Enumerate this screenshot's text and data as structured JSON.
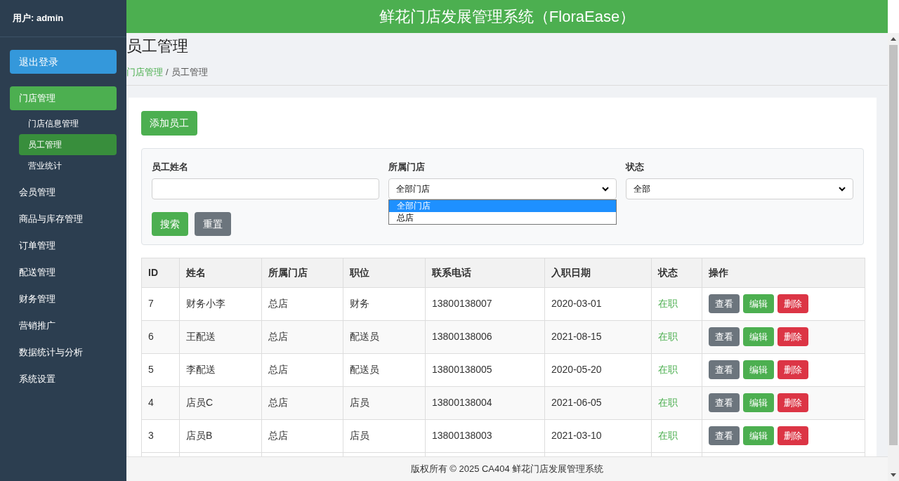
{
  "sidebar": {
    "user": "用户: admin",
    "logout": "退出登录",
    "items": [
      {
        "label": "门店管理",
        "selected": true,
        "children": [
          {
            "label": "门店信息管理",
            "selected": false
          },
          {
            "label": "员工管理",
            "selected": true
          },
          {
            "label": "营业统计",
            "selected": false
          }
        ]
      },
      {
        "label": "会员管理",
        "selected": false
      },
      {
        "label": "商品与库存管理",
        "selected": false
      },
      {
        "label": "订单管理",
        "selected": false
      },
      {
        "label": "配送管理",
        "selected": false
      },
      {
        "label": "财务管理",
        "selected": false
      },
      {
        "label": "营销推广",
        "selected": false
      },
      {
        "label": "数据统计与分析",
        "selected": false
      },
      {
        "label": "系统设置",
        "selected": false
      }
    ]
  },
  "header": {
    "title": "鲜花门店发展管理系统（FloraEase）"
  },
  "page": {
    "title": "员工管理",
    "breadcrumb": [
      {
        "label": "门店管理",
        "link": true
      },
      {
        "label": "员工管理",
        "link": false
      }
    ],
    "separator": "/"
  },
  "add_button": "添加员工",
  "filters": {
    "name": {
      "label": "员工姓名"
    },
    "store": {
      "label": "所属门店",
      "value": "全部门店",
      "open": true,
      "options": [
        {
          "label": "全部门店",
          "selected": true
        },
        {
          "label": "总店",
          "selected": false
        }
      ]
    },
    "status": {
      "label": "状态",
      "value": "全部"
    },
    "buttons": [
      {
        "label": "搜索",
        "kind": "primary"
      },
      {
        "label": "重置",
        "kind": "secondary"
      }
    ]
  },
  "table": {
    "columns": [
      "ID",
      "姓名",
      "所属门店",
      "职位",
      "联系电话",
      "入职日期",
      "状态",
      "操作"
    ],
    "rows": [
      {
        "cells": [
          "7",
          "财务小李",
          "总店",
          "财务",
          "13800138007",
          "2020-03-01"
        ],
        "status": "在职",
        "actions": [
          {
            "label": "查看",
            "kind": "view"
          },
          {
            "label": "编辑",
            "kind": "edit"
          },
          {
            "label": "删除",
            "kind": "delete"
          }
        ]
      },
      {
        "cells": [
          "6",
          "王配送",
          "总店",
          "配送员",
          "13800138006",
          "2021-08-15"
        ],
        "status": "在职",
        "actions": [
          {
            "label": "查看",
            "kind": "view"
          },
          {
            "label": "编辑",
            "kind": "edit"
          },
          {
            "label": "删除",
            "kind": "delete"
          }
        ]
      },
      {
        "cells": [
          "5",
          "李配送",
          "总店",
          "配送员",
          "13800138005",
          "2020-05-20"
        ],
        "status": "在职",
        "actions": [
          {
            "label": "查看",
            "kind": "view"
          },
          {
            "label": "编辑",
            "kind": "edit"
          },
          {
            "label": "删除",
            "kind": "delete"
          }
        ]
      },
      {
        "cells": [
          "4",
          "店员C",
          "总店",
          "店员",
          "13800138004",
          "2021-06-05"
        ],
        "status": "在职",
        "actions": [
          {
            "label": "查看",
            "kind": "view"
          },
          {
            "label": "编辑",
            "kind": "edit"
          },
          {
            "label": "删除",
            "kind": "delete"
          }
        ]
      },
      {
        "cells": [
          "3",
          "店员B",
          "总店",
          "店员",
          "13800138003",
          "2021-03-10"
        ],
        "status": "在职",
        "actions": [
          {
            "label": "查看",
            "kind": "view"
          },
          {
            "label": "编辑",
            "kind": "edit"
          },
          {
            "label": "删除",
            "kind": "delete"
          }
        ]
      }
    ]
  },
  "footer": "版权所有 © 2025 CA404 鲜花门店发展管理系统"
}
